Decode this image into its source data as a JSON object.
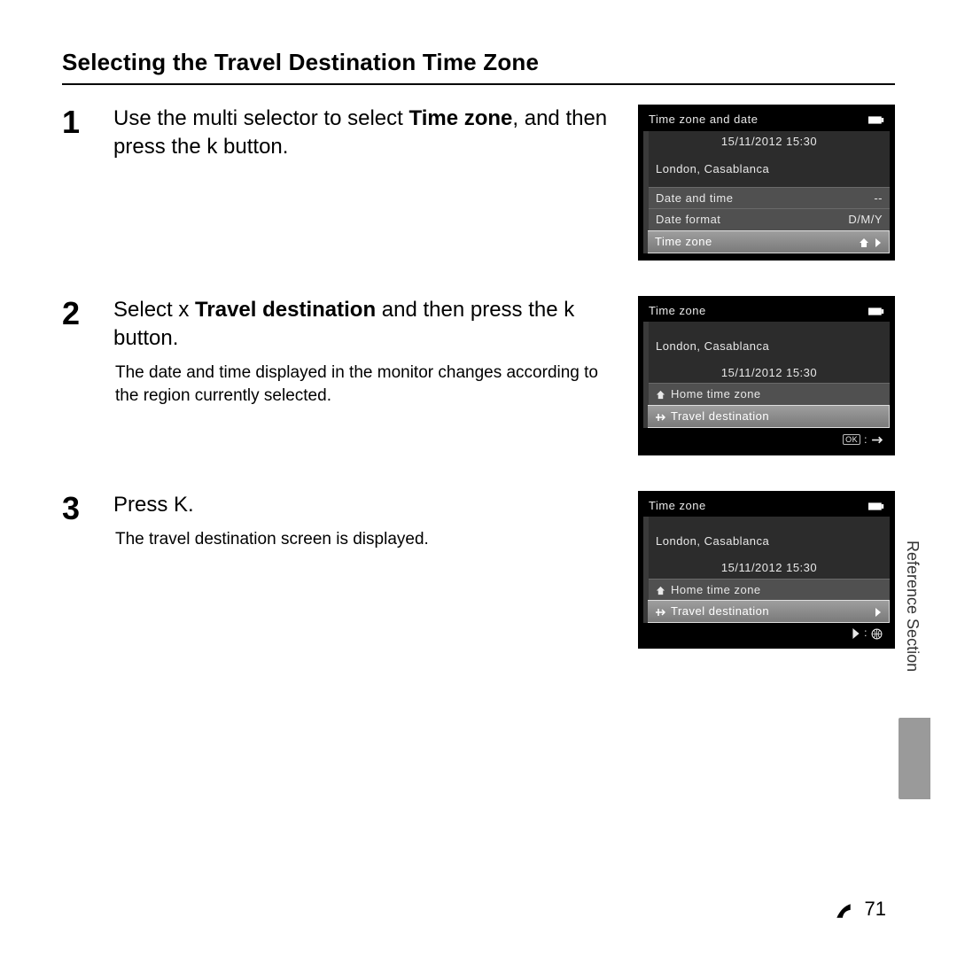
{
  "heading": "Selecting the Travel Destination Time Zone",
  "steps": [
    {
      "num": "1",
      "pre": "Use the multi selector to select ",
      "bold": "Time zone",
      "post": ", and then press the k button.",
      "sub": ""
    },
    {
      "num": "2",
      "pre": "Select x ",
      "bold": "Travel destination",
      "post": " and then press the k button.",
      "sub": "The date and time displayed in the monitor changes according to the region currently selected."
    },
    {
      "num": "3",
      "pre": "Press ",
      "bold": "",
      "post": "K.",
      "sub": "The travel destination screen is displayed."
    }
  ],
  "screens": {
    "s1": {
      "title": "Time zone and date",
      "datetime": "15/11/2012 15:30",
      "city": "London, Casablanca",
      "rows": [
        {
          "label": "Date and time",
          "value": "--"
        },
        {
          "label": "Date format",
          "value": "D/M/Y"
        },
        {
          "label": "Time zone",
          "value_icon": "home-arrow"
        }
      ]
    },
    "s2": {
      "title": "Time zone",
      "city": "London, Casablanca",
      "datetime": "15/11/2012 15:30",
      "home": "Home time zone",
      "travel": "Travel destination",
      "footer_icon": "ok-plane"
    },
    "s3": {
      "title": "Time zone",
      "city": "London, Casablanca",
      "datetime": "15/11/2012 15:30",
      "home": "Home time zone",
      "travel": "Travel destination",
      "footer_icon": "right-globe"
    }
  },
  "side_label": "Reference Section",
  "footer": {
    "prefix": "E",
    "page": "71"
  }
}
